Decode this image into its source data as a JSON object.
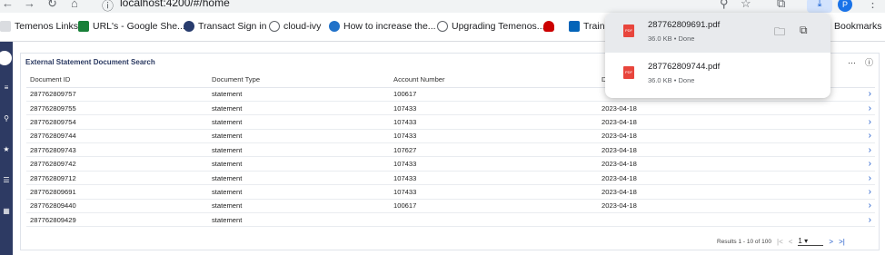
{
  "browser": {
    "address": "localhost:4200/#/home",
    "profile_initial": "P",
    "download_icon": "download-icon"
  },
  "bookmarks": [
    {
      "label": "Temenos Links",
      "icon": "folder-icon",
      "color": "#5f6368"
    },
    {
      "label": "URL's - Google She...",
      "icon": "sheets-icon",
      "color": "#188038"
    },
    {
      "label": "Transact Sign in",
      "icon": "t-icon",
      "color": "#283c6e"
    },
    {
      "label": "cloud-ivy",
      "icon": "globe-icon",
      "color": "#5f6368"
    },
    {
      "label": "How to increase the...",
      "icon": "site-icon",
      "color": "#2172c9"
    },
    {
      "label": "Upgrading Temenos...",
      "icon": "globe-icon",
      "color": "#5f6368"
    },
    {
      "label": "",
      "icon": "redhat-icon",
      "color": "#cc0000"
    },
    {
      "label": "Trainin",
      "icon": "sharepoint-icon",
      "color": "#0364b8"
    },
    {
      "label": "Bookmarks",
      "icon": "",
      "color": "#5f6368"
    }
  ],
  "panel": {
    "title": "External Statement Document Search",
    "columns": [
      "Document ID",
      "Document Type",
      "Account Number",
      "D"
    ],
    "rows": [
      [
        "287762809757",
        "statement",
        "100617",
        ""
      ],
      [
        "287762809755",
        "statement",
        "107433",
        "2023-04-18"
      ],
      [
        "287762809754",
        "statement",
        "107433",
        "2023-04-18"
      ],
      [
        "287762809744",
        "statement",
        "107433",
        "2023-04-18"
      ],
      [
        "287762809743",
        "statement",
        "107627",
        "2023-04-18"
      ],
      [
        "287762809742",
        "statement",
        "107433",
        "2023-04-18"
      ],
      [
        "287762809712",
        "statement",
        "107433",
        "2023-04-18"
      ],
      [
        "287762809691",
        "statement",
        "107433",
        "2023-04-18"
      ],
      [
        "287762809440",
        "statement",
        "100617",
        "2023-04-18"
      ],
      [
        "287762809429",
        "statement",
        "",
        ""
      ]
    ],
    "pager": {
      "results": "Results 1 - 10 of 100",
      "first": "|<",
      "prev": "<",
      "page": "1",
      "next": ">",
      "last": ">|"
    }
  },
  "downloads": [
    {
      "name": "287762809691.pdf",
      "meta": "36.0 KB • Done",
      "icon_label": "PDF"
    },
    {
      "name": "287762809744.pdf",
      "meta": "36.0 KB • Done",
      "icon_label": "PDF"
    }
  ]
}
